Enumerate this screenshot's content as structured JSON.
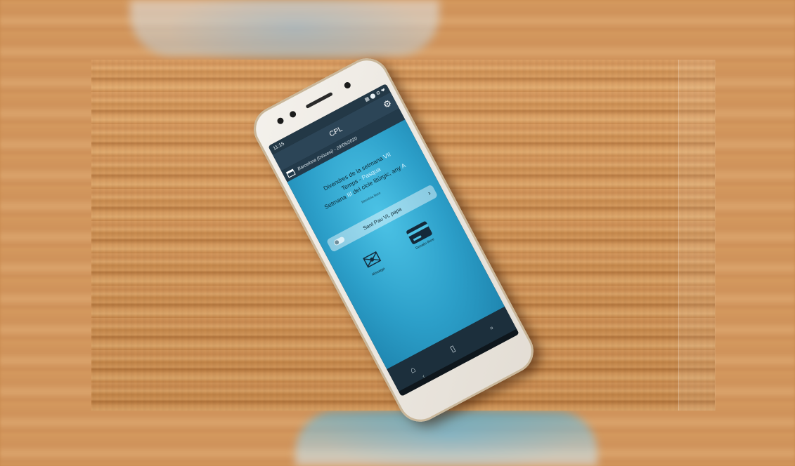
{
  "status_bar": {
    "time": "11:15",
    "icons": "▦ ⬤ ⚙ ❤"
  },
  "app": {
    "title": "CPL"
  },
  "location_date": "Barcelona (Diòcesi) - 29/05/2020",
  "liturgy": {
    "day_prefix": "Divendres de la setmana ",
    "day_week": "VII",
    "season_prefix": "Temps - ",
    "season_name": "Pasqua",
    "cycle_prefix": "Setmana ",
    "cycle_week": "III",
    "cycle_middle": " del cicle litúrgic, any ",
    "cycle_year": "A"
  },
  "memorial_label": "Memòria lliure",
  "celebration": "Sant Pau VI, papa",
  "actions": [
    {
      "label": "Missatge",
      "icon": "envelope-icon"
    },
    {
      "label": "Donatiu lliure",
      "icon": "credit-card-icon"
    }
  ],
  "glyphs": {
    "gear": "⚙",
    "arrow": "›",
    "mail": "✉",
    "home": "⌂",
    "bookmark": "▯",
    "book": "▫",
    "back": "‹"
  }
}
